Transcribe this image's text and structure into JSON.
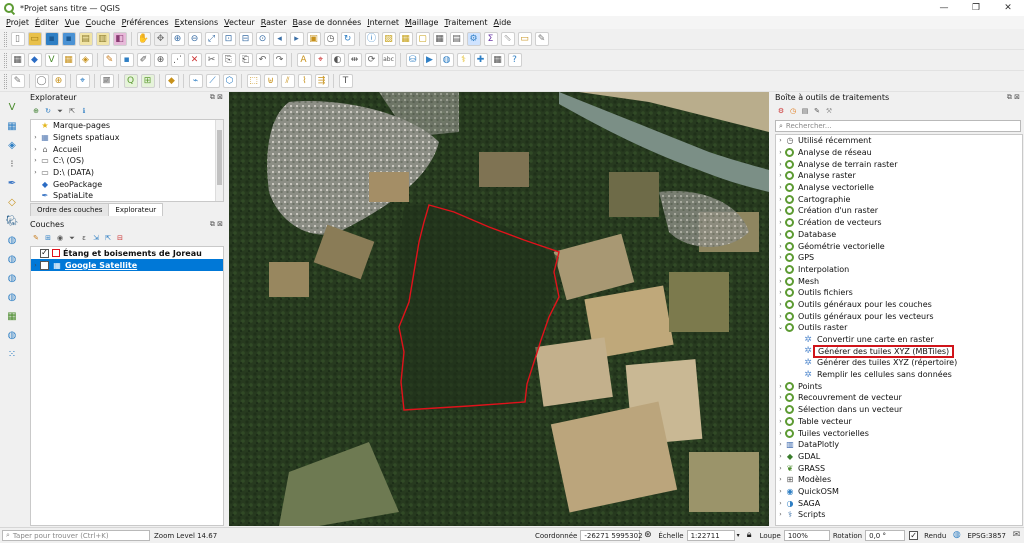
{
  "window": {
    "title": "*Projet sans titre — QGIS",
    "minimize": "—",
    "maximize": "❐",
    "close": "✕"
  },
  "menubar": [
    {
      "pre": "",
      "ul": "P",
      "post": "rojet"
    },
    {
      "pre": "",
      "ul": "É",
      "post": "diter"
    },
    {
      "pre": "",
      "ul": "V",
      "post": "ue"
    },
    {
      "pre": "",
      "ul": "C",
      "post": "ouche"
    },
    {
      "pre": "",
      "ul": "P",
      "post": "références"
    },
    {
      "pre": "",
      "ul": "E",
      "post": "xtensions"
    },
    {
      "pre": "",
      "ul": "V",
      "post": "ecteur"
    },
    {
      "pre": "",
      "ul": "R",
      "post": "aster"
    },
    {
      "pre": "",
      "ul": "B",
      "post": "ase de données"
    },
    {
      "pre": "",
      "ul": "I",
      "post": "nternet"
    },
    {
      "pre": "",
      "ul": "M",
      "post": "aillage"
    },
    {
      "pre": "",
      "ul": "T",
      "post": "raitement"
    },
    {
      "pre": "",
      "ul": "A",
      "post": "ide"
    }
  ],
  "toolbars": {
    "row1": [
      "new-project-icon",
      "open-project-icon",
      "save-project-icon",
      "save-as-icon",
      "print-layout-icon",
      "layout-manager-icon",
      "style-manager-icon",
      "sep",
      "pan-map-icon",
      "pan-to-selection-icon",
      "zoom-in-icon",
      "zoom-out-icon",
      "zoom-full-icon",
      "zoom-to-selection-icon",
      "zoom-to-layer-icon",
      "zoom-native-icon",
      "zoom-last-icon",
      "zoom-next-icon",
      "new-map-view-icon",
      "temporal-controller-icon",
      "refresh-icon",
      "sep",
      "identify-icon",
      "select-features-icon",
      "select-by-value-icon",
      "deselect-icon",
      "open-attribute-table-icon",
      "field-calculator-icon",
      "processing-toolbox-icon",
      "statistics-icon",
      "measure-icon",
      "annotation-icon",
      "map-tips-icon"
    ],
    "row2": [
      "data-source-manager-icon",
      "new-geopackage-icon",
      "new-shapefile-icon",
      "new-temp-layer-icon",
      "new-virtual-layer-icon",
      "sep",
      "edit-layer-icon",
      "save-edits-icon",
      "digitize-icon",
      "add-feature-icon",
      "vertex-tool-icon",
      "delete-icon",
      "cut-icon",
      "copy-icon",
      "paste-icon",
      "undo-icon",
      "redo-icon",
      "sep",
      "label-tool-icon",
      "pin-label-icon",
      "show-hide-label-icon",
      "move-label-icon",
      "rotate-label-icon",
      "change-label-icon",
      "sep",
      "db-manager-icon",
      "python-console-icon",
      "globe-icon",
      "python-icon",
      "plugin-icon",
      "grid-icon",
      "help-icon"
    ],
    "row3": [
      "advanced-digitize-icon",
      "sep",
      "shape-digitize-icon",
      "snapping-icon",
      "sep",
      "georeferencer-icon",
      "sep",
      "profile-icon",
      "sep",
      "quickosm-icon",
      "processing-graph-icon",
      "sep",
      "fill-icon",
      "sep",
      "vector-tools-icon",
      "measure-line-icon",
      "measure-area-icon",
      "sep",
      "select-icon",
      "merge-icon",
      "split-icon",
      "reshape-icon",
      "offset-icon",
      "sep",
      "text-annotation-icon"
    ]
  },
  "vertical_tools": [
    "add-vector-icon",
    "add-raster-icon",
    "add-mesh-icon",
    "add-delimited-icon",
    "add-spatialite-icon",
    "add-virtual-icon",
    "add-postgis-icon",
    "add-wms-icon",
    "add-wfs-icon",
    "add-arcgis-icon",
    "add-xyz-icon",
    "add-vector-tile-icon",
    "add-wcs-icon",
    "add-point-cloud-icon"
  ],
  "explorer": {
    "title": "Explorateur",
    "controls": "⧉ ⊠",
    "items": [
      {
        "label": "Marque-pages",
        "icon": "★",
        "color": "#e3b61c",
        "arrow": ""
      },
      {
        "label": "Signets spatiaux",
        "icon": "▦",
        "color": "#5a7fb5",
        "arrow": "›"
      },
      {
        "label": "Accueil",
        "icon": "⌂",
        "color": "#666666",
        "arrow": "›"
      },
      {
        "label": "C:\\ (OS)",
        "icon": "▭",
        "color": "#666666",
        "arrow": "›"
      },
      {
        "label": "D:\\ (DATA)",
        "icon": "▭",
        "color": "#666666",
        "arrow": "›"
      },
      {
        "label": "GeoPackage",
        "icon": "◆",
        "color": "#2b6cc4",
        "arrow": ""
      },
      {
        "label": "SpatiaLite",
        "icon": "✒",
        "color": "#3a75c4",
        "arrow": ""
      }
    ],
    "tabs": [
      "Ordre des couches",
      "Explorateur"
    ]
  },
  "layers": {
    "title": "Couches",
    "controls": "⧉ ⊠",
    "items": [
      {
        "label": "Étang et boisements de Joreau",
        "checked": "✓",
        "selected": false
      },
      {
        "label": "Google Satellite",
        "checked": "✓",
        "selected": true
      }
    ]
  },
  "toolbox": {
    "title": "Boîte à outils de traitements",
    "controls": "⧉ ⊠",
    "search_placeholder": "Rechercher...",
    "items": [
      {
        "label": "Utilisé récemment",
        "arrow": "›",
        "icon": "clock",
        "indent": 0,
        "highlight": false
      },
      {
        "label": "Analyse de réseau",
        "arrow": "›",
        "icon": "q",
        "indent": 0,
        "highlight": false
      },
      {
        "label": "Analyse de terrain raster",
        "arrow": "›",
        "icon": "q",
        "indent": 0,
        "highlight": false
      },
      {
        "label": "Analyse raster",
        "arrow": "›",
        "icon": "q",
        "indent": 0,
        "highlight": false
      },
      {
        "label": "Analyse vectorielle",
        "arrow": "›",
        "icon": "q",
        "indent": 0,
        "highlight": false
      },
      {
        "label": "Cartographie",
        "arrow": "›",
        "icon": "q",
        "indent": 0,
        "highlight": false
      },
      {
        "label": "Création d'un raster",
        "arrow": "›",
        "icon": "q",
        "indent": 0,
        "highlight": false
      },
      {
        "label": "Création de vecteurs",
        "arrow": "›",
        "icon": "q",
        "indent": 0,
        "highlight": false
      },
      {
        "label": "Database",
        "arrow": "›",
        "icon": "q",
        "indent": 0,
        "highlight": false
      },
      {
        "label": "Géométrie vectorielle",
        "arrow": "›",
        "icon": "q",
        "indent": 0,
        "highlight": false
      },
      {
        "label": "GPS",
        "arrow": "›",
        "icon": "q",
        "indent": 0,
        "highlight": false
      },
      {
        "label": "Interpolation",
        "arrow": "›",
        "icon": "q",
        "indent": 0,
        "highlight": false
      },
      {
        "label": "Mesh",
        "arrow": "›",
        "icon": "q",
        "indent": 0,
        "highlight": false
      },
      {
        "label": "Outils fichiers",
        "arrow": "›",
        "icon": "q",
        "indent": 0,
        "highlight": false
      },
      {
        "label": "Outils généraux pour les couches",
        "arrow": "›",
        "icon": "q",
        "indent": 0,
        "highlight": false
      },
      {
        "label": "Outils généraux pour les vecteurs",
        "arrow": "›",
        "icon": "q",
        "indent": 0,
        "highlight": false
      },
      {
        "label": "Outils raster",
        "arrow": "⌄",
        "icon": "q",
        "indent": 0,
        "highlight": false
      },
      {
        "label": "Convertir une carte en raster",
        "arrow": "",
        "icon": "gear",
        "indent": 1,
        "highlight": false
      },
      {
        "label": "Générer des tuiles XYZ (MBTiles)",
        "arrow": "",
        "icon": "gear",
        "indent": 1,
        "highlight": true
      },
      {
        "label": "Générer des tuiles XYZ (répertoire)",
        "arrow": "",
        "icon": "gear",
        "indent": 1,
        "highlight": false
      },
      {
        "label": "Remplir les cellules sans données",
        "arrow": "",
        "icon": "gear",
        "indent": 1,
        "highlight": false
      },
      {
        "label": "Points",
        "arrow": "›",
        "icon": "q",
        "indent": 0,
        "highlight": false
      },
      {
        "label": "Recouvrement de vecteur",
        "arrow": "›",
        "icon": "q",
        "indent": 0,
        "highlight": false
      },
      {
        "label": "Sélection dans un vecteur",
        "arrow": "›",
        "icon": "q",
        "indent": 0,
        "highlight": false
      },
      {
        "label": "Table vecteur",
        "arrow": "›",
        "icon": "q",
        "indent": 0,
        "highlight": false
      },
      {
        "label": "Tuiles vectorielles",
        "arrow": "›",
        "icon": "q",
        "indent": 0,
        "highlight": false
      },
      {
        "label": "DataPlotly",
        "arrow": "›",
        "icon": "plotly",
        "indent": 0,
        "highlight": false
      },
      {
        "label": "GDAL",
        "arrow": "›",
        "icon": "gdal",
        "indent": 0,
        "highlight": false
      },
      {
        "label": "GRASS",
        "arrow": "›",
        "icon": "grass",
        "indent": 0,
        "highlight": false
      },
      {
        "label": "Modèles",
        "arrow": "›",
        "icon": "model",
        "indent": 0,
        "highlight": false
      },
      {
        "label": "QuickOSM",
        "arrow": "›",
        "icon": "osm",
        "indent": 0,
        "highlight": false
      },
      {
        "label": "SAGA",
        "arrow": "›",
        "icon": "saga",
        "indent": 0,
        "highlight": false
      },
      {
        "label": "Scripts",
        "arrow": "›",
        "icon": "python",
        "indent": 0,
        "highlight": false
      }
    ]
  },
  "statusbar": {
    "locator_placeholder": "Taper pour trouver (Ctrl+K)",
    "zoom_level": "Zoom Level 14.67",
    "coordinate_label": "Coordonnée",
    "coordinate_value": "-26271 5995302",
    "scale_label": "Échelle",
    "scale_value": "1:22711",
    "magnifier_label": "Loupe",
    "magnifier_value": "100%",
    "rotation_label": "Rotation",
    "rotation_value": "0,0 °",
    "render_label": "Rendu",
    "render_checked": "✓",
    "crs_label": "EPSG:3857"
  },
  "colors": {
    "accent": "#0078d7",
    "highlight_box": "#d0141a",
    "qgis_green": "#5d9b33",
    "parcel_outline": "#e0121b"
  }
}
